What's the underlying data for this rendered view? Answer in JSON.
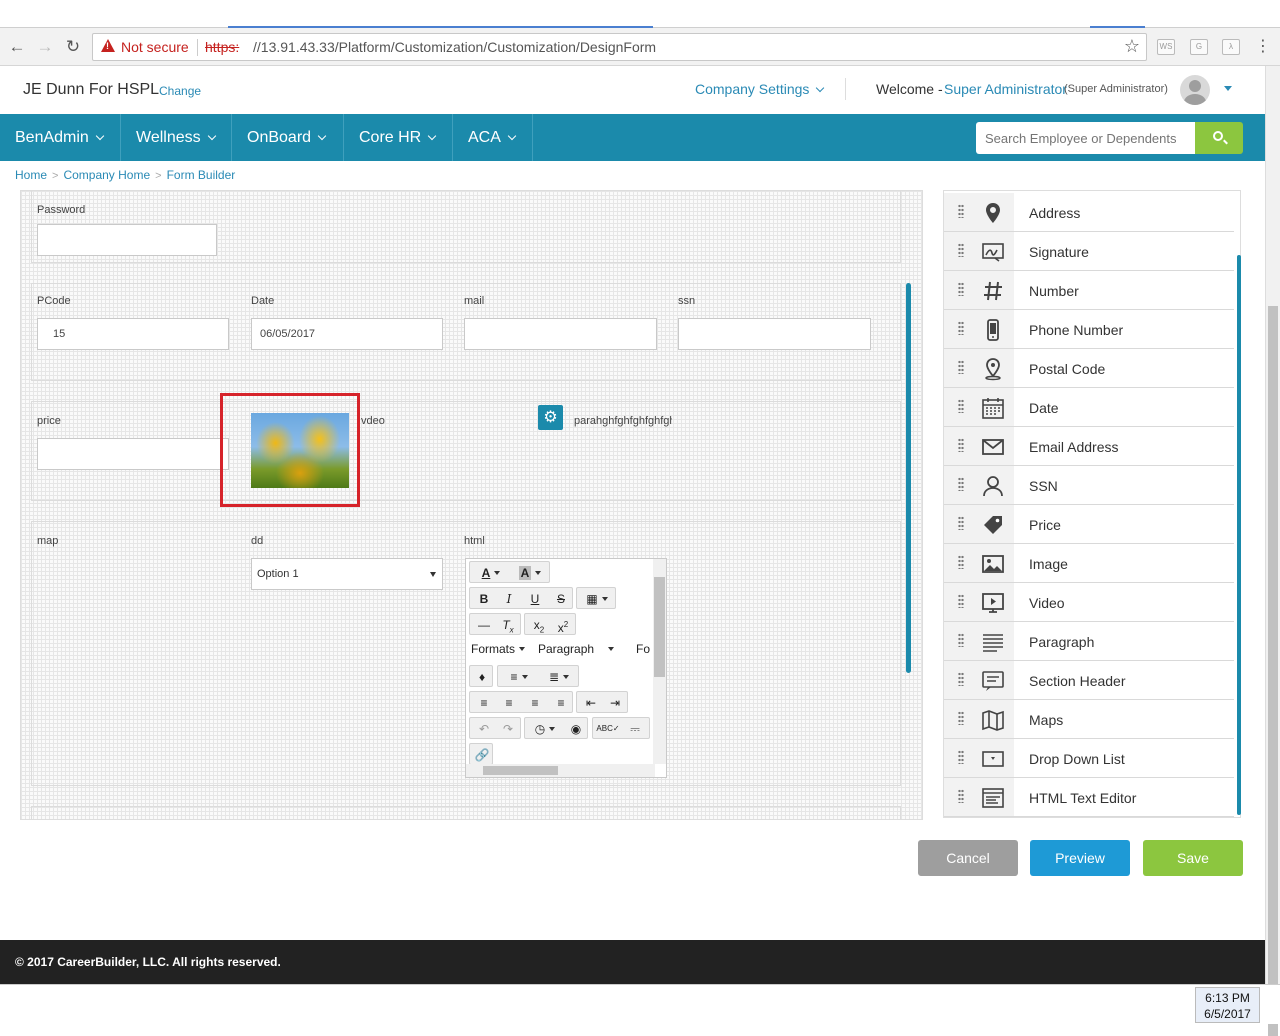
{
  "browser": {
    "security_label": "Not secure",
    "url_scheme": "https:",
    "url_rest": "//13.91.43.33/Platform/Customization/Customization/DesignForm"
  },
  "header": {
    "company": "JE Dunn For HSPL",
    "change": "Change",
    "company_settings": "Company Settings",
    "welcome": "Welcome -",
    "user_name": "Super Administrator",
    "user_role": "(Super Administrator)"
  },
  "nav": {
    "items": [
      "BenAdmin",
      "Wellness",
      "OnBoard",
      "Core HR",
      "ACA"
    ],
    "search_placeholder": "Search Employee or Dependents"
  },
  "breadcrumb": [
    "Home",
    "Company Home",
    "Form Builder"
  ],
  "form": {
    "password_label": "Password",
    "pcode_label": "PCode",
    "pcode_value": "15",
    "date_label": "Date",
    "date_value": "06/05/2017",
    "mail_label": "mail",
    "ssn_label": "ssn",
    "price_label": "price",
    "video_label": "vdeo",
    "paragraph_label": "parahghfghfghfghfgh",
    "map_label": "map",
    "dd_label": "dd",
    "dd_value": "Option 1",
    "html_label": "html",
    "editor": {
      "formats": "Formats",
      "block": "Paragraph",
      "font_stub": "Fo"
    }
  },
  "palette": [
    {
      "label": "Address",
      "icon": "map-marker-icon"
    },
    {
      "label": "Signature",
      "icon": "signature-icon"
    },
    {
      "label": "Number",
      "icon": "hash-icon"
    },
    {
      "label": "Phone Number",
      "icon": "mobile-phone-icon"
    },
    {
      "label": "Postal Code",
      "icon": "postal-marker-icon"
    },
    {
      "label": "Date",
      "icon": "calendar-icon"
    },
    {
      "label": "Email Address",
      "icon": "envelope-icon"
    },
    {
      "label": "SSN",
      "icon": "user-icon"
    },
    {
      "label": "Price",
      "icon": "price-tag-icon"
    },
    {
      "label": "Image",
      "icon": "image-icon"
    },
    {
      "label": "Video",
      "icon": "video-icon"
    },
    {
      "label": "Paragraph",
      "icon": "paragraph-lines-icon"
    },
    {
      "label": "Section Header",
      "icon": "section-header-icon"
    },
    {
      "label": "Maps",
      "icon": "folded-map-icon"
    },
    {
      "label": "Drop Down List",
      "icon": "dropdown-icon"
    },
    {
      "label": "HTML Text Editor",
      "icon": "html-editor-icon"
    }
  ],
  "actions": {
    "cancel": "Cancel",
    "preview": "Preview",
    "save": "Save"
  },
  "footer": {
    "copyright": "© 2017 CareerBuilder, LLC. All rights reserved."
  },
  "taskbar": {
    "time": "6:13 PM",
    "date": "6/5/2017"
  },
  "colors": {
    "nav": "#1b8aab",
    "link": "#2a8ab5",
    "search_button": "#8cc63f",
    "cancel": "#9e9e9e",
    "preview": "#1e9ad6",
    "save": "#8cc63f",
    "highlight": "#d6232a"
  }
}
